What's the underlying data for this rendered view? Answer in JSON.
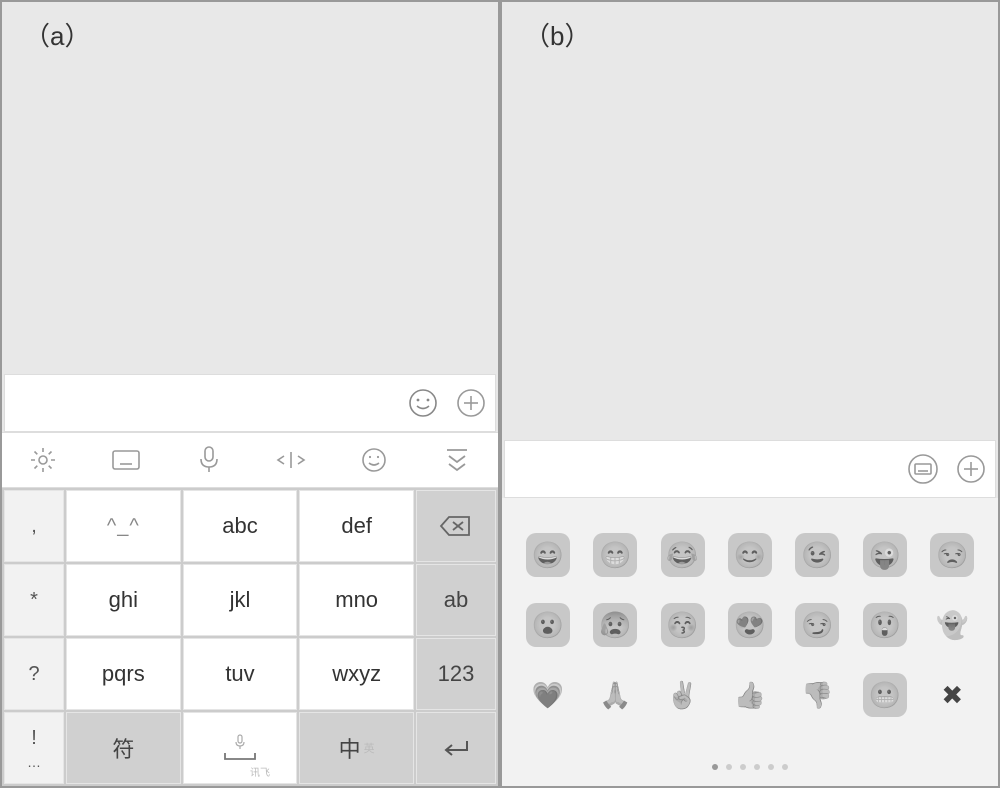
{
  "labels": {
    "a": "（a）",
    "b": "（b）"
  },
  "panelA": {
    "input_placeholder": "",
    "toolbar": {
      "settings": "settings-icon",
      "keyboard": "keyboard-icon",
      "mic": "mic-icon",
      "cursor": "cursor-icon",
      "emoji": "emoji-icon",
      "collapse": "collapse-icon"
    },
    "keypad": {
      "side": [
        ",",
        "*",
        "?",
        "!",
        "…"
      ],
      "rows": [
        [
          "^_^",
          "abc",
          "def"
        ],
        [
          "ghi",
          "jkl",
          "mno"
        ],
        [
          "pqrs",
          "tuv",
          "wxyz"
        ],
        [
          "符",
          "space",
          "中"
        ]
      ],
      "right": [
        "backspace",
        "ab",
        "123",
        "enter"
      ],
      "space_sub": "讯飞",
      "lang_sub": "英"
    }
  },
  "panelB": {
    "input_placeholder": "",
    "emoji_rows": [
      [
        "😄",
        "😁",
        "😂",
        "😊",
        "😉",
        "😜",
        "😒"
      ],
      [
        "😮",
        "😰",
        "😚",
        "😍",
        "😏",
        "😲",
        "👻"
      ],
      [
        "💗",
        "🙏",
        "✌",
        "👍",
        "👎",
        "😬",
        "✖"
      ]
    ],
    "pages": {
      "total": 6,
      "current": 0
    }
  }
}
